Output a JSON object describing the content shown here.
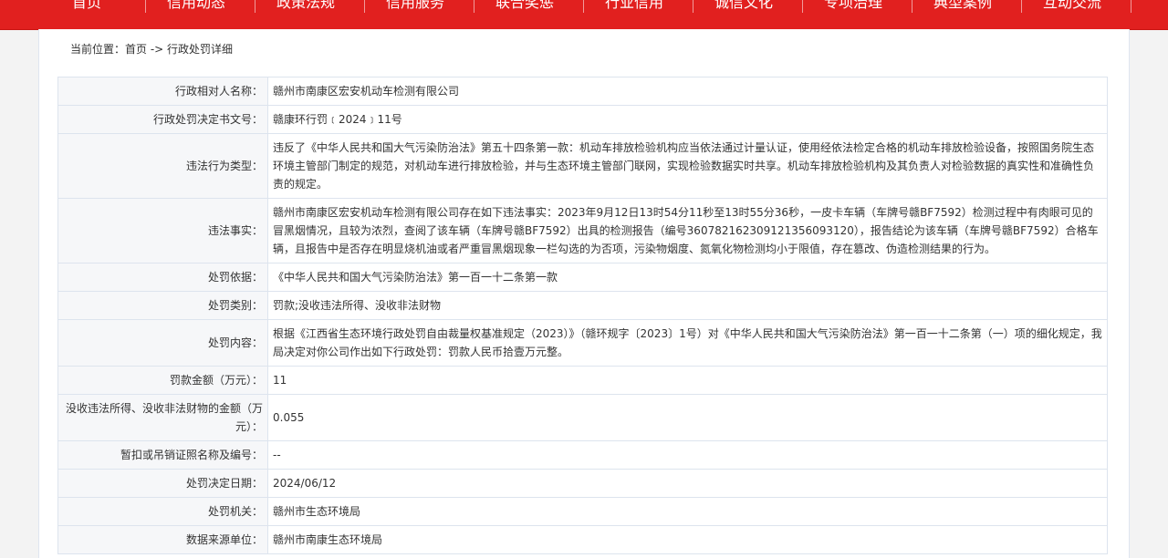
{
  "nav": {
    "items": [
      "首页",
      "信用动态",
      "政策法规",
      "信用服务",
      "联合奖惩",
      "行业信用",
      "诚信文化",
      "专项治理",
      "典型案例",
      "互动交流"
    ]
  },
  "breadcrumb": {
    "prefix": "当前位置：",
    "home": "首页",
    "separator": " -> ",
    "current": "行政处罚详细"
  },
  "detail": {
    "rows": [
      {
        "label": "行政相对人名称：",
        "value": "赣州市南康区宏安机动车检测有限公司"
      },
      {
        "label": "行政处罚决定书文号：",
        "value": "赣康环行罚﹝2024﹞11号"
      },
      {
        "label": "违法行为类型：",
        "value": "违反了《中华人民共和国大气污染防治法》第五十四条第一款：机动车排放检验机构应当依法通过计量认证，使用经依法检定合格的机动车排放检验设备，按照国务院生态环境主管部门制定的规范，对机动车进行排放检验，并与生态环境主管部门联网，实现检验数据实时共享。机动车排放检验机构及其负责人对检验数据的真实性和准确性负责的规定。"
      },
      {
        "label": "违法事实：",
        "value": "赣州市南康区宏安机动车检测有限公司存在如下违法事实：2023年9月12日13时54分11秒至13时55分36秒，一皮卡车辆（车牌号赣BF7592）检测过程中有肉眼可见的冒黑烟情况，且较为浓烈，查阅了该车辆（车牌号赣BF7592）出具的检测报告（编号360782162309121356093120），报告结论为该车辆（车牌号赣BF7592）合格车辆，且报告中是否存在明显烧机油或者严重冒黑烟现象一栏勾选的为否项，污染物烟度、氮氧化物检测均小于限值，存在篡改、伪造检测结果的行为。"
      },
      {
        "label": "处罚依据：",
        "value": "《中华人民共和国大气污染防治法》第一百一十二条第一款"
      },
      {
        "label": "处罚类别：",
        "value": "罚款;没收违法所得、没收非法财物"
      },
      {
        "label": "处罚内容：",
        "value": "根据《江西省生态环境行政处罚自由裁量权基准规定（2023）》（赣环规字〔2023〕1号）对《中华人民共和国大气污染防治法》第一百一十二条第（一）项的细化规定，我局决定对你公司作出如下行政处罚：罚款人民币拾壹万元整。"
      },
      {
        "label": "罚款金额（万元）：",
        "value": "11"
      },
      {
        "label": "没收违法所得、没收非法财物的金额（万元）：",
        "value": "0.055"
      },
      {
        "label": "暂扣或吊销证照名称及编号：",
        "value": "--"
      },
      {
        "label": "处罚决定日期：",
        "value": "2024/06/12"
      },
      {
        "label": "处罚机关：",
        "value": "赣州市生态环境局"
      },
      {
        "label": "数据来源单位：",
        "value": "赣州市南康生态环境局"
      }
    ]
  }
}
